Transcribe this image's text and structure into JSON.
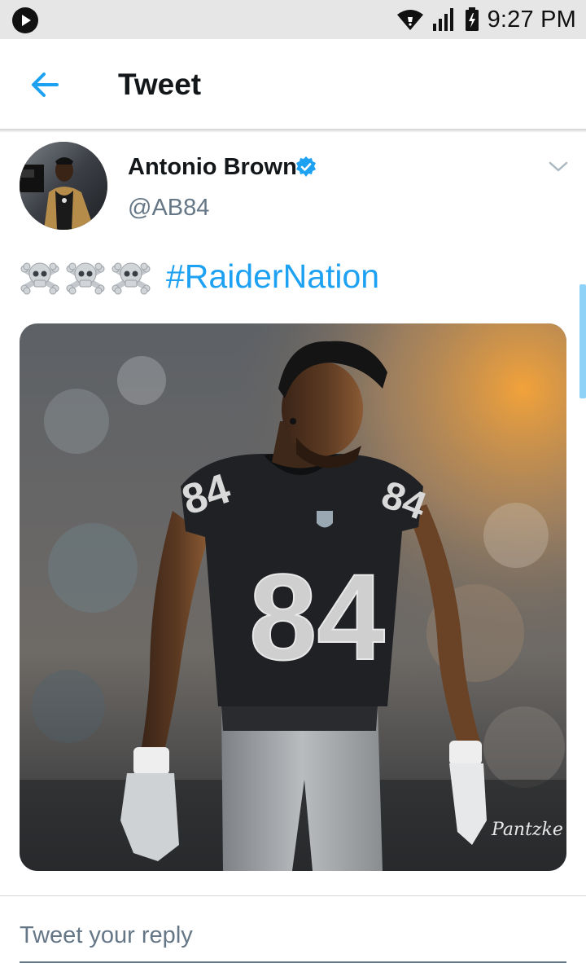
{
  "status_bar": {
    "time": "9:27 PM",
    "icons": [
      "play-icon",
      "wifi-icon",
      "signal-icon",
      "battery-charging-icon"
    ]
  },
  "header": {
    "title": "Tweet",
    "back_icon": "back-arrow-icon"
  },
  "tweet": {
    "author_name": "Antonio Brown",
    "handle": "@AB84",
    "verified": true,
    "text_emoji": [
      "skull-crossbones",
      "skull-crossbones",
      "skull-crossbones"
    ],
    "hashtag": "#RaiderNation",
    "photo": {
      "jersey_number": "84",
      "watermark": "Pantzke"
    }
  },
  "reply": {
    "placeholder": "Tweet your reply"
  },
  "colors": {
    "accent": "#1da1f2",
    "text_primary": "#14171a",
    "text_secondary": "#657786",
    "status_bar_bg": "#e6e6e6"
  }
}
